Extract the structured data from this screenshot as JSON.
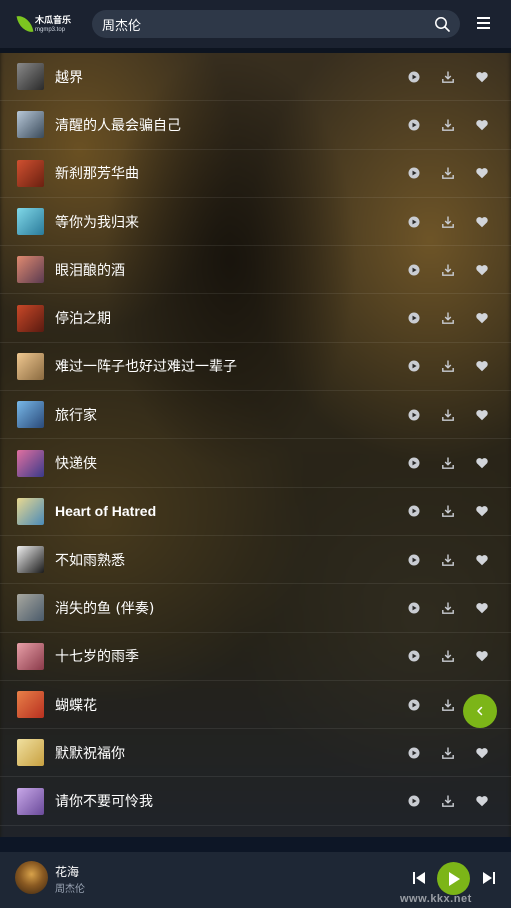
{
  "header": {
    "logo_main": "木瓜音乐",
    "logo_sub": "mgmp3.top",
    "search_value": "周杰伦"
  },
  "songs": [
    {
      "title": "越界",
      "thumb": [
        "#8a8a8a",
        "#2a2a2a"
      ]
    },
    {
      "title": "清醒的人最会骗自己",
      "thumb": [
        "#b8c8d8",
        "#3a4a5a"
      ]
    },
    {
      "title": "新刹那芳华曲",
      "thumb": [
        "#d05030",
        "#6a2010"
      ]
    },
    {
      "title": "等你为我归来",
      "thumb": [
        "#80d8e8",
        "#2a7a9a"
      ]
    },
    {
      "title": "眼泪酿的酒",
      "thumb": [
        "#e08a70",
        "#5a3a50"
      ]
    },
    {
      "title": "停泊之期",
      "thumb": [
        "#c84828",
        "#5a1a10"
      ]
    },
    {
      "title": "难过一阵子也好过难过一辈子",
      "thumb": [
        "#f0c890",
        "#8a6a40"
      ]
    },
    {
      "title": "旅行家",
      "thumb": [
        "#78b8e8",
        "#2a4a7a"
      ]
    },
    {
      "title": "快递侠",
      "thumb": [
        "#e070a0",
        "#3a3a8a"
      ]
    },
    {
      "title": "Heart of Hatred",
      "thumb": [
        "#e8d890",
        "#4a8ab8"
      ]
    },
    {
      "title": "不如雨熟悉",
      "thumb": [
        "#f0f0f0",
        "#1a1a1a"
      ]
    },
    {
      "title": "消失的鱼 (伴奏)",
      "thumb": [
        "#a8a8a0",
        "#4a5a6a"
      ]
    },
    {
      "title": "十七岁的雨季",
      "thumb": [
        "#e8a0a8",
        "#8a3a4a"
      ]
    },
    {
      "title": "蝴蝶花",
      "thumb": [
        "#e88048",
        "#b83020"
      ]
    },
    {
      "title": "默默祝福你",
      "thumb": [
        "#f0e0a0",
        "#c8a040"
      ]
    },
    {
      "title": "请你不要可怜我",
      "thumb": [
        "#c8a8e8",
        "#6a4a9a"
      ]
    }
  ],
  "player": {
    "title": "花海",
    "artist": "周杰伦"
  },
  "watermark": "www.kkx.net",
  "colors": {
    "accent": "#7cb518",
    "header_bg": "#1b2230",
    "player_bg": "#1e2735"
  }
}
